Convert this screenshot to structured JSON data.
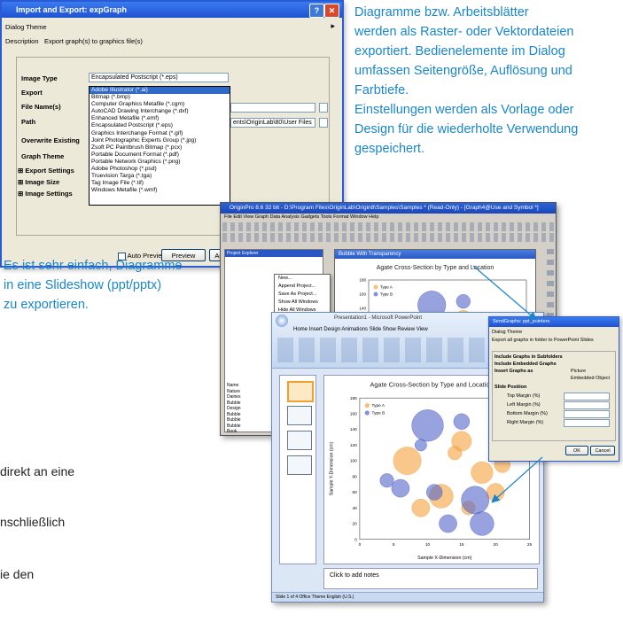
{
  "caption_top": [
    "Diagramme bzw. Arbeitsblätter",
    "werden als Raster- oder Vektordateien",
    "exportiert. Bedienelemente im Dialog",
    "umfassen Seitengröße, Auflösung und",
    "Farbtiefe.",
    "Einstellungen werden als Vorlage oder",
    "Design für die wiederholte Verwendung",
    "gespeichert."
  ],
  "caption_left": [
    "Es ist sehr einfach, Diagramme",
    "in eine Slideshow (ppt/pptx)",
    "zu exportieren."
  ],
  "body_fragments": [
    "direkt an eine",
    "nschließlich",
    "ie den"
  ],
  "export_dialog": {
    "title": "Import and Export: expGraph",
    "dialog_theme_label": "Dialog Theme",
    "description_label": "Description",
    "description_value": "Export graph(s) to graphics file(s)",
    "image_type_label": "Image Type",
    "image_type_value": "Encapsulated Postscript (*.eps)",
    "export_label": "Export",
    "file_names_label": "File Name(s)",
    "path_label": "Path",
    "path_value": "ents\\OriginLab\\80\\User Files",
    "overwrite_label": "Overwrite Existing",
    "graph_theme_label": "Graph Theme",
    "export_settings_label": "Export Settings",
    "image_size_label": "Image Size",
    "image_settings_label": "Image Settings",
    "image_types": [
      "Adobe Illustrator (*.ai)",
      "Bitmap (*.bmp)",
      "Computer Graphics Metafile (*.cgm)",
      "AutoCAD Drawing Interchange (*.dxf)",
      "Enhanced Metafile (*.emf)",
      "Encapsulated Postscript (*.eps)",
      "Graphics Interchange Format (*.gif)",
      "Joint Photographic Experts Group (*.jpg)",
      "Zsoft PC Paintbrush Bitmap (*.pcx)",
      "Portable Document Format (*.pdf)",
      "Portable Network Graphics (*.png)",
      "Adobe Photoshop (*.psd)",
      "Truevision Targa (*.tga)",
      "Tag Image File (*.tif)",
      "Windows Metafile (*.wmf)"
    ],
    "auto_preview_label": "Auto Preview",
    "preview_button": "Preview",
    "apply_button": "Ap"
  },
  "origin_window": {
    "title": "OriginPro 8.6 32 bit - D:\\Program Files\\OriginLab\\Origin8\\Samples\\Samples * (Read-Only) - [Graph4@Use and Symbol *]",
    "menu": [
      "File",
      "Edit",
      "View",
      "Graph",
      "Data",
      "Analysis",
      "Gadgets",
      "Tools",
      "Format",
      "Window",
      "Help"
    ],
    "explorer_title": "Project Explorer",
    "graph_title": "Bubble With Transparency",
    "context_menu": [
      "New...",
      "Append Project...",
      "Save As Project...",
      "Show All Windows",
      "Hide All Windows",
      "Delete Folder",
      "Rename",
      "Duplicate Folder",
      "Open Window",
      "Open Folder",
      "New Window",
      "Send Graphs to PowerPoint",
      "Send Graphs to Word...",
      "Properties..."
    ],
    "explorer_list": [
      "Name",
      "Nature",
      "Dairies",
      "Bubble",
      "Design",
      "Bubble",
      "Bubble",
      "Bubble",
      "Book"
    ]
  },
  "ppt_dialog": {
    "title": "SendGraphs: ppt_pointers",
    "dialog_theme": "Dialog Theme",
    "description": "Export all graphs in folder to PowerPoint Slides",
    "include_graphs": "Include Graphs in Subfolders",
    "include_embedded": "Include Embedded Graphs",
    "insert_graphs_as": "Insert Graphs as",
    "picture": "Picture",
    "embedded_object": "Embedded Object",
    "slide_position": "Slide Position",
    "top_margin": "Top Margin (%)",
    "left_margin": "Left Margin (%)",
    "bottom_margin": "Bottom Margin (%)",
    "right_margin": "Right Margin (%)",
    "ok": "OK",
    "cancel": "Cancel"
  },
  "ppt_window": {
    "title": "Presentation1 - Microsoft PowerPoint",
    "tabs": [
      "Home",
      "Insert",
      "Design",
      "Animations",
      "Slide Show",
      "Review",
      "View"
    ],
    "notes_placeholder": "Click to add notes",
    "status": "Slide 1 of 4     Office Theme     English (U.S.)"
  },
  "chart_data": [
    {
      "type": "scatter",
      "title": "Agate Cross-Section by Type and Location",
      "xlabel": "Sample X-Dimension (cm)",
      "ylabel": "Sample Y-Dimension (cm)",
      "xlim": [
        0,
        25
      ],
      "ylim": [
        0,
        180
      ],
      "x_ticks": [
        0,
        5,
        10,
        15,
        20,
        25
      ],
      "y_ticks": [
        0,
        20,
        40,
        60,
        80,
        100,
        120,
        140,
        160,
        180
      ],
      "legend_position": "top-left",
      "series": [
        {
          "name": "Type A",
          "color": "#f5a23c",
          "points": [
            [
              7,
              100,
              14
            ],
            [
              12,
              55,
              12
            ],
            [
              15,
              125,
              10
            ],
            [
              18,
              85,
              11
            ],
            [
              20,
              60,
              9
            ],
            [
              21,
              95,
              8
            ],
            [
              16,
              40,
              7
            ],
            [
              9,
              40,
              9
            ],
            [
              14,
              110,
              7
            ]
          ]
        },
        {
          "name": "Type B",
          "color": "#5464c8",
          "points": [
            [
              10,
              145,
              16
            ],
            [
              11,
              60,
              8
            ],
            [
              4,
              75,
              7
            ],
            [
              6,
              65,
              9
            ],
            [
              17,
              50,
              14
            ],
            [
              13,
              20,
              9
            ],
            [
              18,
              20,
              12
            ],
            [
              15,
              150,
              8
            ],
            [
              9,
              120,
              6
            ]
          ]
        }
      ]
    }
  ]
}
